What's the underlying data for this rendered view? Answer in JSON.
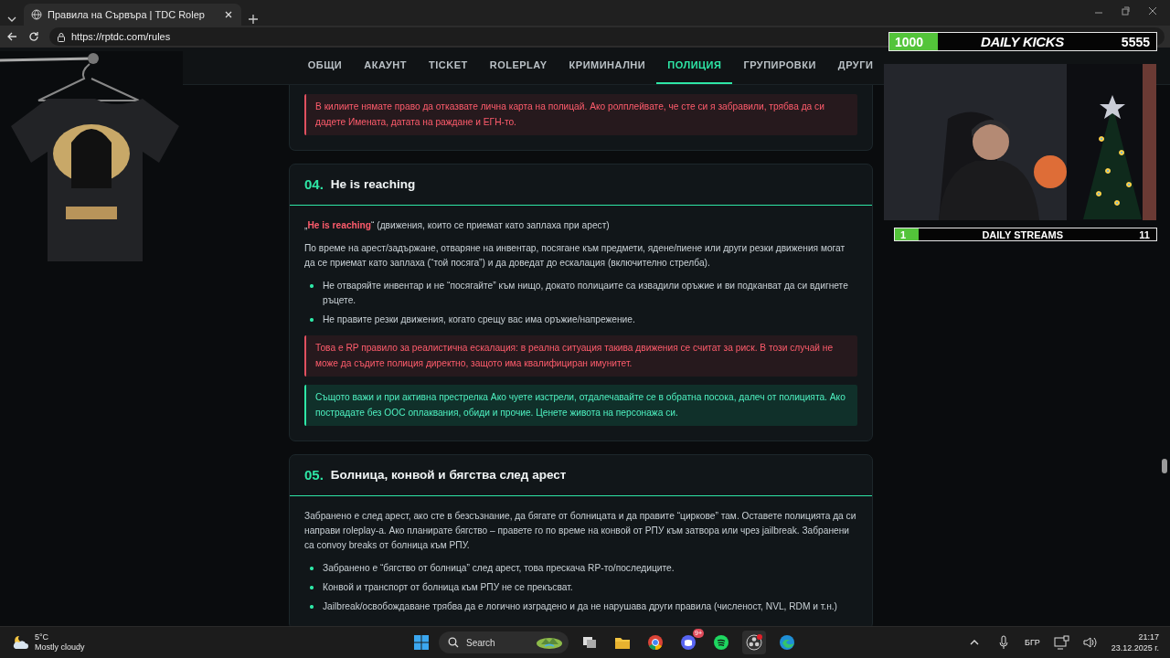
{
  "browser": {
    "tab_title": "Правила на Сървъра | TDC Rolep",
    "url": "https://rptdc.com/rules"
  },
  "nav": {
    "items": [
      {
        "label": "ОБЩИ",
        "selected": false
      },
      {
        "label": "АКАУНТ",
        "selected": false
      },
      {
        "label": "TICKET",
        "selected": false
      },
      {
        "label": "ROLEPLAY",
        "selected": false
      },
      {
        "label": "КРИМИНАЛНИ",
        "selected": false
      },
      {
        "label": "ПОЛИЦИЯ",
        "selected": true
      },
      {
        "label": "ГРУПИРОВКИ",
        "selected": false
      },
      {
        "label": "ДРУГИ",
        "selected": false
      }
    ]
  },
  "sections": [
    {
      "blocks": [
        {
          "kind": "note_red",
          "text": "В килиите нямате право да отказвате лична карта на полицай. Ако ролплейвате, че сте си я забравили, трябва да си дадете Имената, датата на раждане и ЕГН-то."
        }
      ]
    },
    {
      "number": "04.",
      "title": "He is reaching",
      "blocks": [
        {
          "kind": "paragraph",
          "text": "„**He is reaching**“ (движения, които се приемат като заплаха при арест)"
        },
        {
          "kind": "paragraph",
          "text": "По време на арест/задържане, отваряне на инвентар, посягане към предмети, ядене/пиене или други резки движения могат да се приемат като заплаха (“той посяга”) и да доведат до ескалация (включително стрелба)."
        },
        {
          "kind": "list",
          "items": [
            "Не отваряйте инвентар и не “посягайте” към нищо, докато полицаите са извадили оръжие и ви подканват да си вдигнете ръцете.",
            "Не правите резки движения, когато срещу вас има оръжие/напрежение."
          ]
        },
        {
          "kind": "note_red",
          "text": "Това е RP правило за реалистична ескалация: в реална ситуация такива движения се считат за риск. В този случай не може да съдите полиция директно, защото има квалифициран имунитет."
        },
        {
          "kind": "note_green",
          "text": "Същото важи и при активна престрелка Ако чуете изстрели, отдалечавайте се в обратна посока, далеч от полицията. Ако пострадате без ООС оплаквания, обиди и прочие. Ценете живота на персонажа си."
        }
      ]
    },
    {
      "number": "05.",
      "title": "Болница, конвой и бягства след арест",
      "blocks": [
        {
          "kind": "paragraph",
          "text": "Забранено е след арест, ако сте в безсъзнание, да бягате от болницата и да правите “циркове” там. Оставете полицията да си направи roleplay-а. Ако планирате бягство – правете го по време на конвой от РПУ към затвора или чрез jailbreak. Забранени са convoy breaks от болница към РПУ."
        },
        {
          "kind": "list",
          "items": [
            "Забранено е “бягство от болница” след арест, това прескача RP-то/последиците.",
            "Конвой и транспорт от болница към РПУ не се прекъсват.",
            "Jailbreak/освобождаване трябва да е логично изградено и да не нарушава други правила (численост, NVL, RDM и т.н.)"
          ]
        }
      ]
    }
  ],
  "stream_overlay": {
    "goals": [
      {
        "kind": "kicks",
        "current": "1000",
        "title": "DAILY KICKS",
        "target": "5555",
        "level": 0.18
      },
      {
        "kind": "streams",
        "current": "1",
        "title": "DAILY STREAMS",
        "target": "11",
        "level": 0.09
      }
    ]
  },
  "taskbar": {
    "weather": {
      "temperature": "5°C",
      "condition": "Mostly cloudy"
    },
    "search": {
      "placeholder": "Search"
    },
    "discord_badge": "9+",
    "language": "БГР",
    "time": "21:17",
    "date": "23.12.2025 г."
  }
}
